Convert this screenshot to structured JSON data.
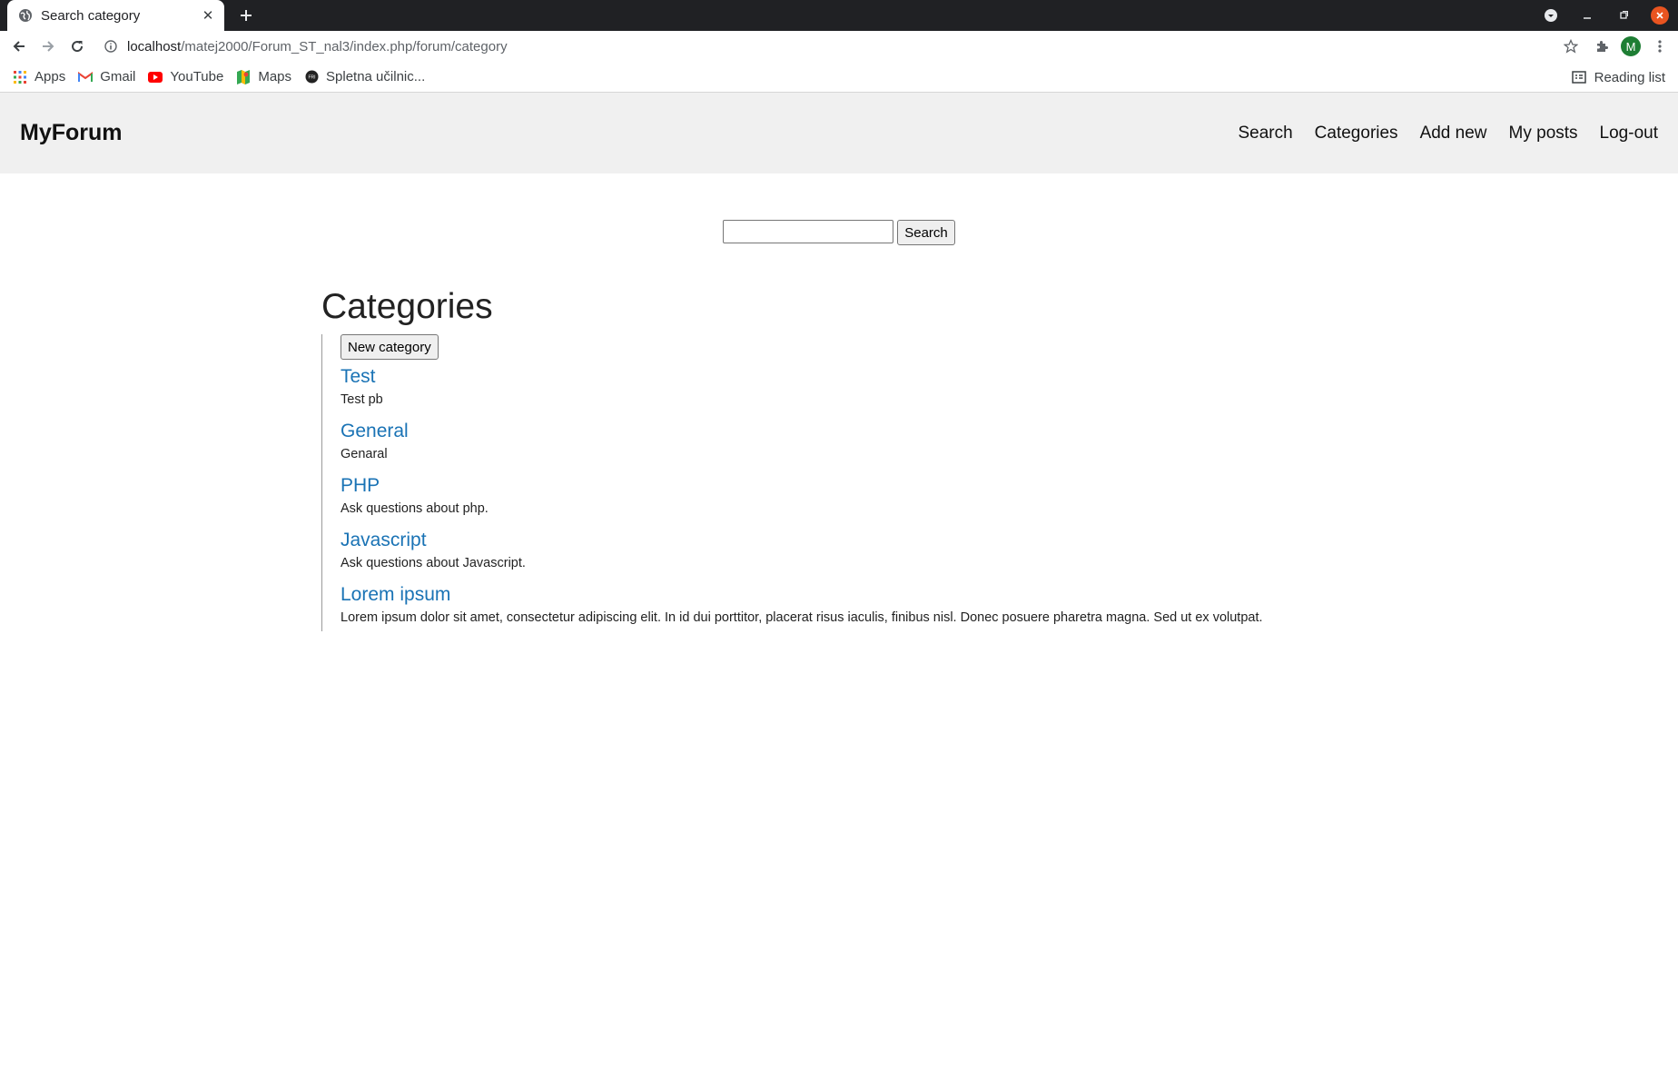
{
  "browser": {
    "tab_title": "Search category",
    "url_host": "localhost",
    "url_path": "/matej2000/Forum_ST_nal3/index.php/forum/category",
    "profile_initial": "M",
    "bookmarks": [
      {
        "label": "Apps",
        "icon": "apps-grid-icon"
      },
      {
        "label": "Gmail",
        "icon": "gmail-icon"
      },
      {
        "label": "YouTube",
        "icon": "youtube-icon"
      },
      {
        "label": "Maps",
        "icon": "maps-icon"
      },
      {
        "label": "Spletna učilnic...",
        "icon": "fri-icon"
      }
    ],
    "reading_list": "Reading list"
  },
  "site": {
    "brand": "MyForum",
    "nav": [
      "Search",
      "Categories",
      "Add new",
      "My posts",
      "Log-out"
    ]
  },
  "search": {
    "placeholder": "",
    "button_label": "Search"
  },
  "main": {
    "title": "Categories",
    "new_category_label": "New category",
    "categories": [
      {
        "name": "Test",
        "description": "Test pb"
      },
      {
        "name": "General",
        "description": "Genaral"
      },
      {
        "name": "PHP",
        "description": "Ask questions about php."
      },
      {
        "name": "Javascript",
        "description": "Ask questions about Javascript."
      },
      {
        "name": "Lorem ipsum",
        "description": "Lorem ipsum dolor sit amet, consectetur adipiscing elit. In id dui porttitor, placerat risus iaculis, finibus nisl. Donec posuere pharetra magna. Sed ut ex volutpat."
      }
    ]
  },
  "colors": {
    "link": "#1a73b5",
    "header_bg": "#f0f0f0",
    "chrome_dark": "#202124",
    "close_orange": "#e95420"
  }
}
